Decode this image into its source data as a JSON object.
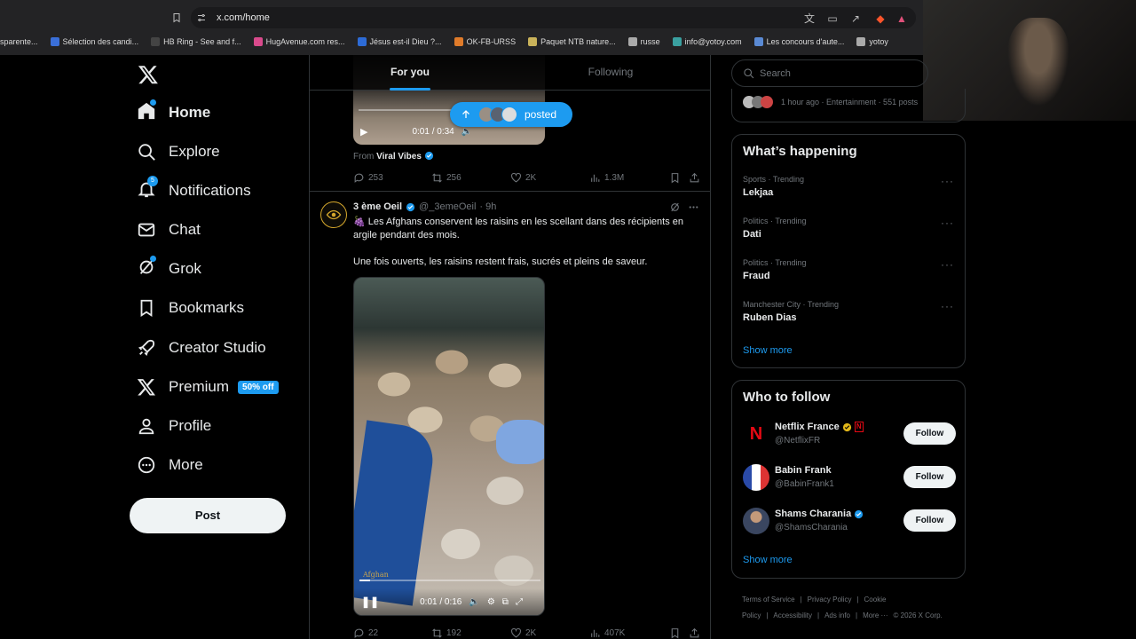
{
  "browser": {
    "url": "x.com/home",
    "bookmarks": [
      {
        "label": "sparente...",
        "color": "#888"
      },
      {
        "label": "Sélection des candi...",
        "color": "#3a6fd8"
      },
      {
        "label": "HB Ring - See and f...",
        "color": "#444"
      },
      {
        "label": "HugAvenue.com res...",
        "color": "#d94a8c"
      },
      {
        "label": "Jésus est-il Dieu ?...",
        "color": "#2d6bd6"
      },
      {
        "label": "OK-FB-URSS",
        "color": "#e07b2a"
      },
      {
        "label": "Paquet NTB nature...",
        "color": "#c9b25a"
      },
      {
        "label": "russe",
        "color": "#aaa"
      },
      {
        "label": "info@yotoy.com",
        "color": "#3aa0a0"
      },
      {
        "label": "Les concours d'aute...",
        "color": "#5a8ad4"
      },
      {
        "label": "yotoy",
        "color": "#aaa"
      }
    ]
  },
  "nav": {
    "items": [
      {
        "label": "Home",
        "icon": "home-icon"
      },
      {
        "label": "Explore",
        "icon": "search-icon"
      },
      {
        "label": "Notifications",
        "icon": "bell-icon"
      },
      {
        "label": "Chat",
        "icon": "mail-icon"
      },
      {
        "label": "Grok",
        "icon": "grok-icon"
      },
      {
        "label": "Bookmarks",
        "icon": "bookmark-icon"
      },
      {
        "label": "Creator Studio",
        "icon": "rocket-icon"
      },
      {
        "label": "Premium",
        "icon": "x-icon"
      },
      {
        "label": "Profile",
        "icon": "person-icon"
      },
      {
        "label": "More",
        "icon": "more-circle-icon"
      }
    ],
    "notif_count": "5",
    "premium_badge": "50% off",
    "post_label": "Post"
  },
  "feed": {
    "tabs": [
      "For you",
      "Following"
    ],
    "posted_pill": "posted",
    "tweet1": {
      "time": "0:01 / 0:34",
      "from_prefix": "From",
      "from_name": "Viral Vibes",
      "replies": "253",
      "reposts": "256",
      "likes": "2K",
      "views": "1.3M"
    },
    "tweet2": {
      "name": "3 ème Oeil",
      "handle": "@_3emeOeil",
      "age": "· 9h",
      "text1": "🍇 Les Afghans conservent les raisins en les scellant dans des récipients en argile pendant des mois.",
      "text2": "Une fois ouverts, les raisins restent frais, sucrés et pleins de saveur.",
      "watermark": "Afghan",
      "time": "0:01 / 0:16",
      "replies": "22",
      "reposts": "192",
      "likes": "2K",
      "views": "407K"
    }
  },
  "right": {
    "search_placeholder": "Search",
    "news_meta": "1 hour ago · Entertainment · 551 posts",
    "happening_title": "What’s happening",
    "trends": [
      {
        "meta": "Sports · Trending",
        "name": "Lekjaa"
      },
      {
        "meta": "Politics · Trending",
        "name": "Dati"
      },
      {
        "meta": "Politics · Trending",
        "name": "Fraud"
      },
      {
        "meta": "Manchester City · Trending",
        "name": "Ruben Dias"
      }
    ],
    "show_more": "Show more",
    "wtf_title": "Who to follow",
    "follow": [
      {
        "name": "Netflix France",
        "handle": "@NetflixFR",
        "avatar": "#000"
      },
      {
        "name": "Babin Frank",
        "handle": "@BabinFrank1",
        "avatar": "#2a4a8a"
      },
      {
        "name": "Shams Charania",
        "handle": "@ShamsCharania",
        "avatar": "#3a4660"
      }
    ],
    "follow_label": "Follow",
    "footer": [
      "Terms of Service",
      "|",
      "Privacy Policy",
      "|",
      "Cookie Policy",
      "|",
      "Accessibility",
      "|",
      "Ads info",
      "|",
      "More ···",
      "© 2026 X Corp."
    ]
  }
}
